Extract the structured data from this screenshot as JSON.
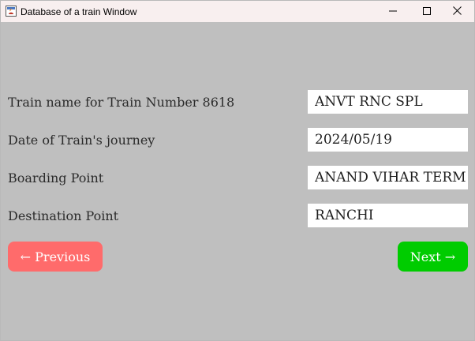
{
  "window": {
    "title": "Database of a train Window"
  },
  "form": {
    "train_name_label": "Train name for Train Number 8618",
    "train_name_value": "ANVT RNC SPL",
    "date_label": "Date of Train's journey",
    "date_value": "2024/05/19",
    "boarding_label": "Boarding Point",
    "boarding_value": "ANAND VIHAR TERM",
    "destination_label": "Destination Point",
    "destination_value": "RANCHI"
  },
  "buttons": {
    "previous_label": "← Previous",
    "previous_color": "#ff6b6b",
    "next_label": "Next →",
    "next_color": "#00cc00"
  },
  "colors": {
    "background": "#bfbfbf",
    "titlebar": "#f8efef"
  },
  "icons": {
    "app": "java-app-icon",
    "minimize": "minimize-icon",
    "maximize": "maximize-icon",
    "close": "close-icon"
  }
}
